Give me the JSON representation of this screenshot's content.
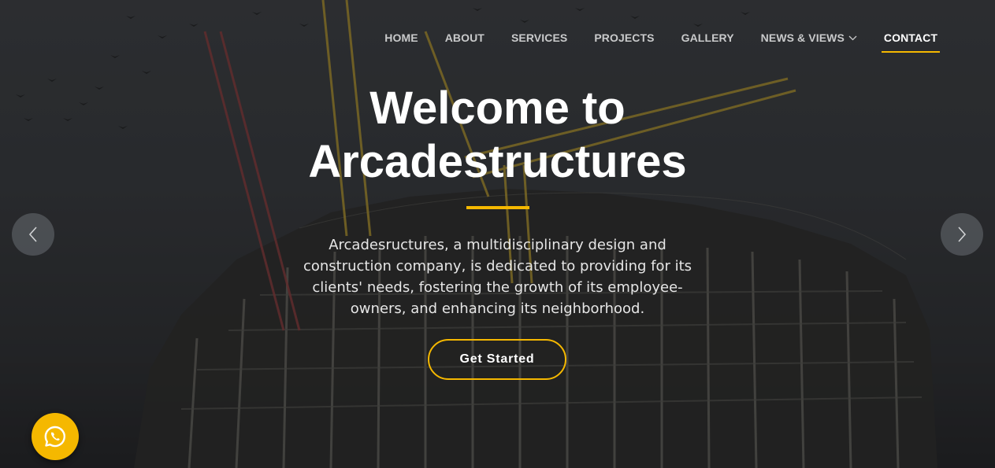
{
  "nav": {
    "items": [
      {
        "label": "HOME",
        "active": false
      },
      {
        "label": "ABOUT",
        "active": false
      },
      {
        "label": "SERVICES",
        "active": false
      },
      {
        "label": "PROJECTS",
        "active": false
      },
      {
        "label": "GALLERY",
        "active": false
      },
      {
        "label": "NEWS & VIEWS",
        "active": false,
        "dropdown": true
      },
      {
        "label": "CONTACT",
        "active": true
      }
    ]
  },
  "hero": {
    "title_line1": "Welcome to",
    "title_line2": "Arcadestructures",
    "description": "Arcadesructures, a multidisciplinary design and construction company, is dedicated to providing for its clients' needs, fostering the growth of its employee-owners, and enhancing its neighborhood.",
    "cta_label": "Get Started",
    "background": "construction-cranes-photo"
  },
  "controls": {
    "prev_icon": "chevron-left-icon",
    "next_icon": "chevron-right-icon",
    "chat_icon": "whatsapp-icon"
  },
  "colors": {
    "accent": "#f5b800",
    "text": "#ffffff",
    "nav_text": "#c9cacb"
  }
}
